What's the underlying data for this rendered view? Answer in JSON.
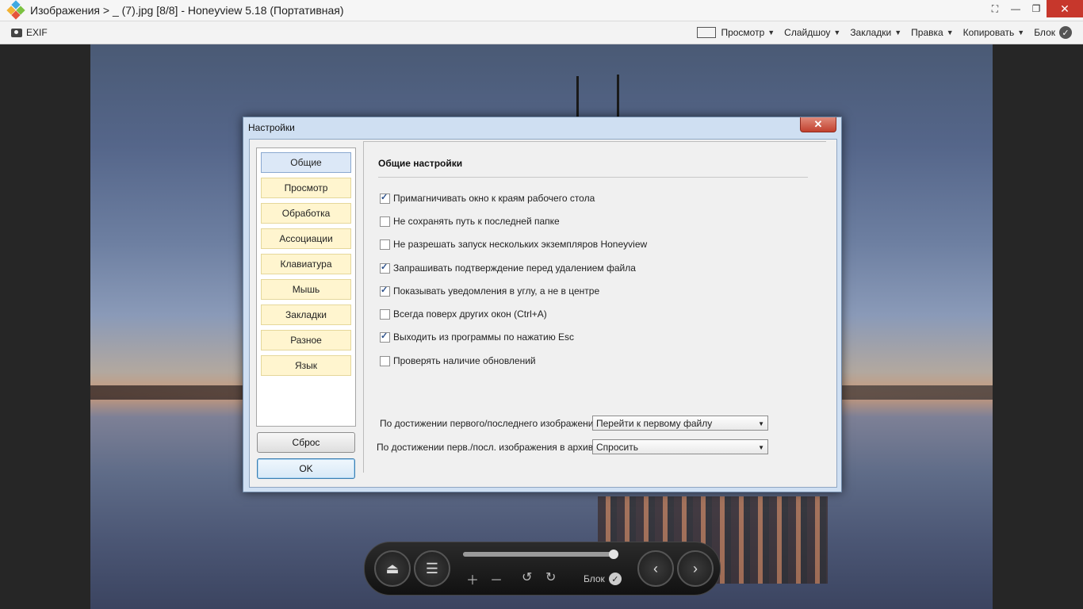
{
  "window": {
    "title": "Изображения > _ (7).jpg [8/8] - Honeyview 5.18 (Портативная)",
    "close_glyph": "✕",
    "maximize_glyph": "❐",
    "minimize_glyph": "—",
    "fullscreen_glyph": "⛶"
  },
  "toolbar": {
    "exif": "EXIF",
    "view": "Просмотр",
    "slideshow": "Слайдшоу",
    "bookmarks": "Закладки",
    "edit": "Правка",
    "copy": "Копировать",
    "block": "Блок",
    "caret": "▼"
  },
  "dialog": {
    "title": "Настройки",
    "close_glyph": "✕",
    "nav_items": [
      "Общие",
      "Просмотр",
      "Обработка",
      "Ассоциации",
      "Клавиатура",
      "Мышь",
      "Закладки",
      "Разное",
      "Язык"
    ],
    "reset_button": "Сброс",
    "ok_button": "OK",
    "section_title": "Общие настройки",
    "options": [
      {
        "label": "Примагничивать окно к краям рабочего стола",
        "checked": true
      },
      {
        "label": "Не сохранять путь к последней папке",
        "checked": false
      },
      {
        "label": "Не разрешать запуск нескольких экземпляров Honeyview",
        "checked": false
      },
      {
        "label": "Запрашивать подтверждение перед удалением файла",
        "checked": true
      },
      {
        "label": "Показывать уведомления в углу, а не в центре",
        "checked": true
      },
      {
        "label": "Всегда поверх других окон (Ctrl+A)",
        "checked": false
      },
      {
        "label": "Выходить из программы по нажатию Esc",
        "checked": true
      },
      {
        "label": "Проверять наличие обновлений",
        "checked": false
      }
    ],
    "first_last_label": "По достижении первого/последнего изображения:",
    "first_last_value": "Перейти к первому файлу",
    "archive_label": "По достижении перв./посл. изображения в архиве:",
    "archive_value": "Спросить"
  },
  "controls": {
    "block": "Блок",
    "progress": 0.98
  },
  "colors": {
    "accent": "#3c7fb1",
    "close_red": "#c7372c",
    "nav_bg": "#fff5cf"
  }
}
